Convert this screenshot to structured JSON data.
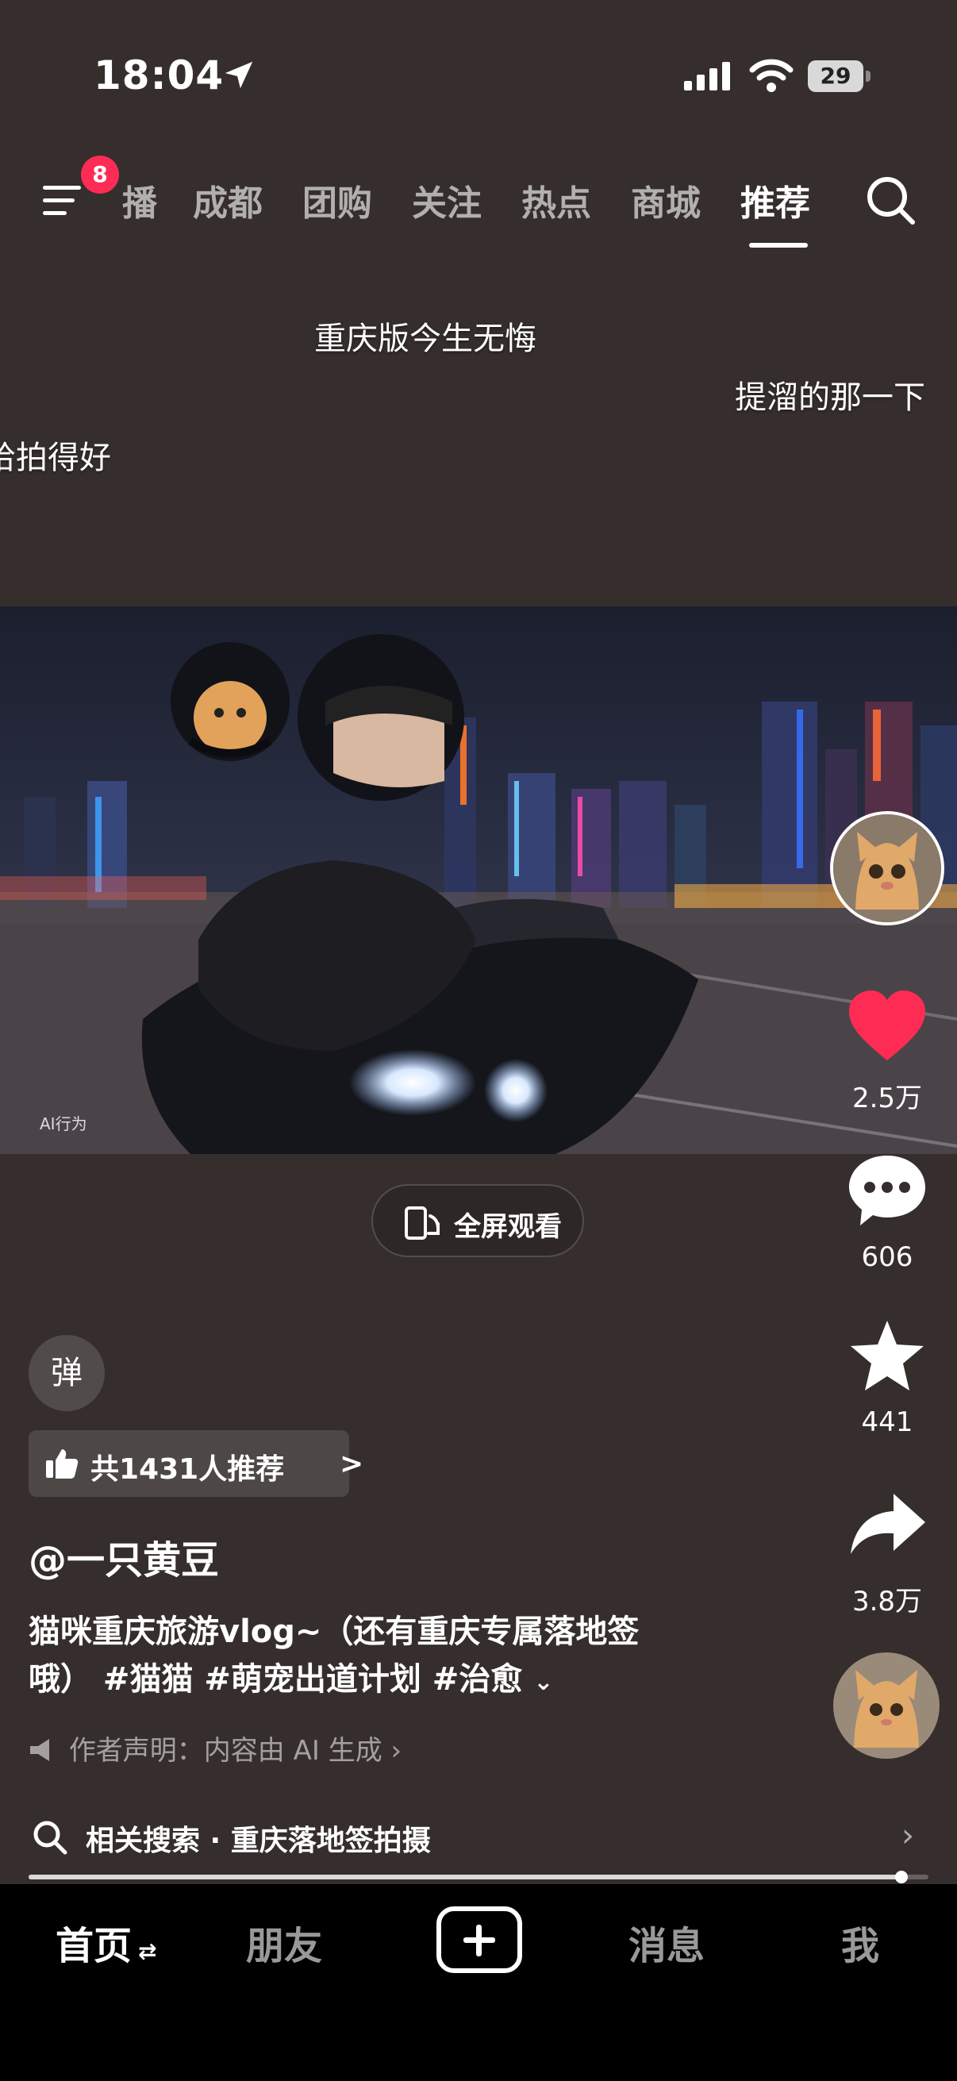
{
  "status_bar": {
    "time": "18:04",
    "battery": "29"
  },
  "top_nav": {
    "menu_badge": "8",
    "tabs": [
      "播",
      "成都",
      "团购",
      "关注",
      "热点",
      "商城",
      "推荐"
    ],
    "active_tab": "推荐"
  },
  "danmaku": [
    "重庆版今生无悔",
    "提溜的那一下",
    "哈拍得好"
  ],
  "video": {
    "ai_tag": "AI行为"
  },
  "fullscreen_label": "全屏观看",
  "actions": {
    "likes": "2.5万",
    "comments": "606",
    "favorites": "441",
    "shares": "3.8万"
  },
  "danmaku_toggle": "弹",
  "recommend": {
    "label": "共1431人推荐",
    "chevron": ">"
  },
  "author": "@一只黄豆",
  "caption": {
    "line1": "猫咪重庆旅游vlog~（还有重庆专属落地签",
    "line2": "哦） #猫猫 #萌宠出道计划 #治愈",
    "expand": "⌄"
  },
  "statement": "作者声明：内容由 AI 生成 ›",
  "related_search": {
    "label": "相关搜索 · 重庆落地签拍摄",
    "chevron": "›"
  },
  "progress": 0.97,
  "bottom_tabs": {
    "home": "首页",
    "friends": "朋友",
    "messages": "消息",
    "me": "我",
    "swap": "⇄"
  },
  "colors": {
    "accent": "#fe2c55",
    "background": "#352e2d"
  }
}
